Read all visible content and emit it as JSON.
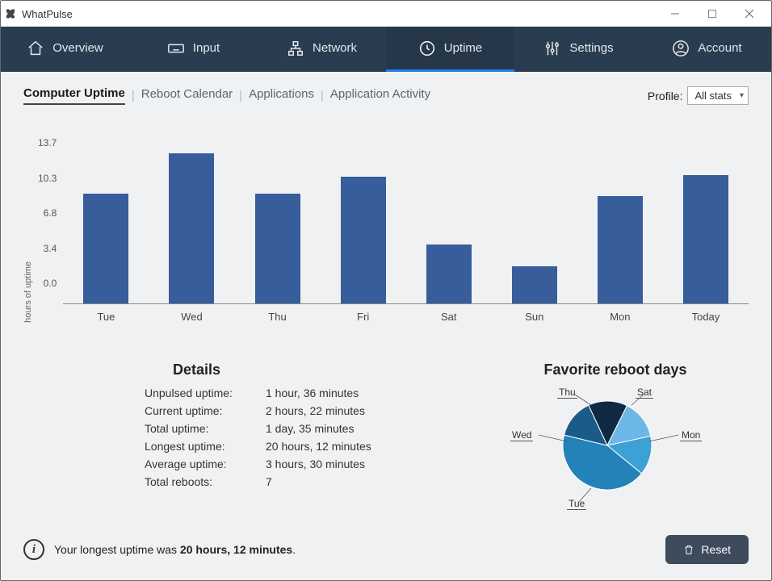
{
  "window": {
    "title": "WhatPulse"
  },
  "tabs": [
    {
      "label": "Overview"
    },
    {
      "label": "Input"
    },
    {
      "label": "Network"
    },
    {
      "label": "Uptime"
    },
    {
      "label": "Settings"
    },
    {
      "label": "Account"
    }
  ],
  "subtabs": {
    "items": [
      "Computer Uptime",
      "Reboot Calendar",
      "Applications",
      "Application Activity"
    ],
    "active": 0
  },
  "profile": {
    "label": "Profile:",
    "value": "All stats"
  },
  "chart_data": {
    "type": "bar",
    "ylabel": "hours of uptime",
    "ylim": [
      0,
      13.7
    ],
    "yticks": [
      "13.7",
      "10.3",
      "6.8",
      "3.4",
      "0.0"
    ],
    "categories": [
      "Tue",
      "Wed",
      "Thu",
      "Fri",
      "Sat",
      "Sun",
      "Mon",
      "Today"
    ],
    "values": [
      10.0,
      13.7,
      10.0,
      11.6,
      5.4,
      3.4,
      9.8,
      11.7
    ]
  },
  "details": {
    "heading": "Details",
    "rows": [
      {
        "k": "Unpulsed uptime:",
        "v": "1 hour, 36 minutes"
      },
      {
        "k": "Current uptime:",
        "v": "2 hours, 22 minutes"
      },
      {
        "k": "Total uptime:",
        "v": "1 day, 35 minutes"
      },
      {
        "k": "Longest uptime:",
        "v": "20 hours, 12 minutes"
      },
      {
        "k": "Average uptime:",
        "v": "3 hours, 30 minutes"
      },
      {
        "k": "Total reboots:",
        "v": "7"
      }
    ]
  },
  "favorite": {
    "heading": "Favorite reboot days",
    "type": "pie",
    "labels": [
      "Thu",
      "Sat",
      "Mon",
      "Tue",
      "Wed"
    ],
    "slices": [
      {
        "label": "Thu",
        "value": 1,
        "color": "#0f2b44"
      },
      {
        "label": "Sat",
        "value": 1,
        "color": "#6bb8e6"
      },
      {
        "label": "Mon",
        "value": 1,
        "color": "#3ea1d6"
      },
      {
        "label": "Tue",
        "value": 3,
        "color": "#2382b7"
      },
      {
        "label": "Wed",
        "value": 1,
        "color": "#1b5b88"
      }
    ]
  },
  "footer": {
    "message_pre": "Your longest uptime was ",
    "message_bold": "20 hours, 12 minutes",
    "message_post": ".",
    "reset": "Reset"
  }
}
